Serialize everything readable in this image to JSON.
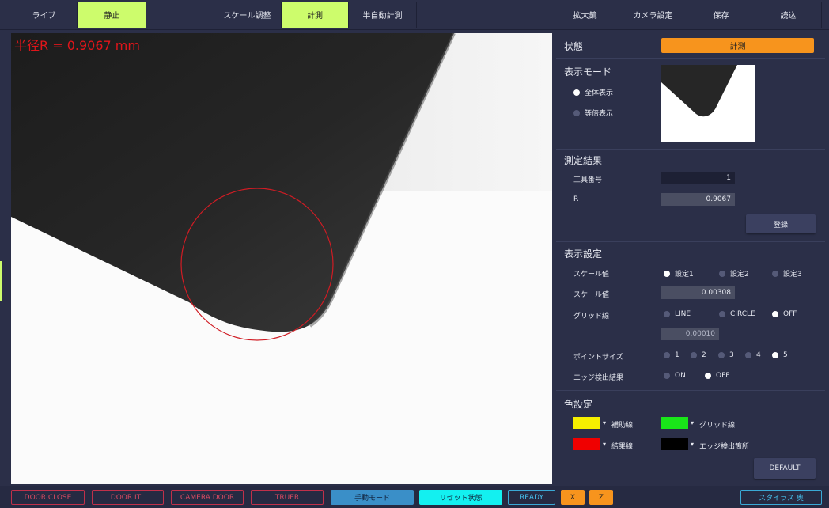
{
  "toolbar": {
    "live": "ライブ",
    "still": "静止",
    "scale_adjust": "スケール調整",
    "measure": "計測",
    "semi_auto": "半自動計測",
    "magnifier": "拡大鏡",
    "camera_settings": "カメラ設定",
    "save": "保存",
    "load": "読込"
  },
  "view": {
    "radius_label": "半径R = 0.9067 mm"
  },
  "panel": {
    "state_title": "状態",
    "state_value": "計測",
    "display_mode_title": "表示モード",
    "display_mode_options": [
      "全体表示",
      "等倍表示"
    ],
    "display_mode_selected": "全体表示",
    "result_title": "測定結果",
    "tool_number_label": "工具番号",
    "tool_number_value": "1",
    "r_label": "R",
    "r_value": "0.9067",
    "register_button": "登録",
    "display_settings_title": "表示設定",
    "scale_value_label": "スケール値",
    "scale_presets": [
      "設定1",
      "設定2",
      "設定3"
    ],
    "scale_preset_selected": "設定1",
    "scale_value_label2": "スケール値",
    "scale_value": "0.00308",
    "grid_label": "グリッド線",
    "grid_options": [
      "LINE",
      "CIRCLE",
      "OFF"
    ],
    "grid_selected": "OFF",
    "grid_value": "0.00010",
    "point_size_label": "ポイントサイズ",
    "point_sizes": [
      "1",
      "2",
      "3",
      "4",
      "5"
    ],
    "point_size_selected": "5",
    "edge_label": "エッジ検出結果",
    "edge_options": [
      "ON",
      "OFF"
    ],
    "edge_selected": "OFF",
    "color_title": "色設定",
    "aux_line_label": "補助線",
    "grid_line_label": "グリッド線",
    "result_line_label": "結果線",
    "edge_point_label": "エッジ検出箇所",
    "default_button": "DEFAULT",
    "colors": {
      "aux_line": "#f6f000",
      "grid_line": "#19e619",
      "result_line": "#f00000",
      "edge_point": "#000000"
    }
  },
  "bottom": {
    "door_close": "DOOR CLOSE",
    "door_itl": "DOOR ITL",
    "camera_door": "CAMERA DOOR",
    "truer": "TRUER",
    "manual_mode": "手動モード",
    "reset_state": "リセット状態",
    "ready": "READY",
    "x": "X",
    "z": "Z",
    "stylus_status": "スタイラス 奥"
  }
}
